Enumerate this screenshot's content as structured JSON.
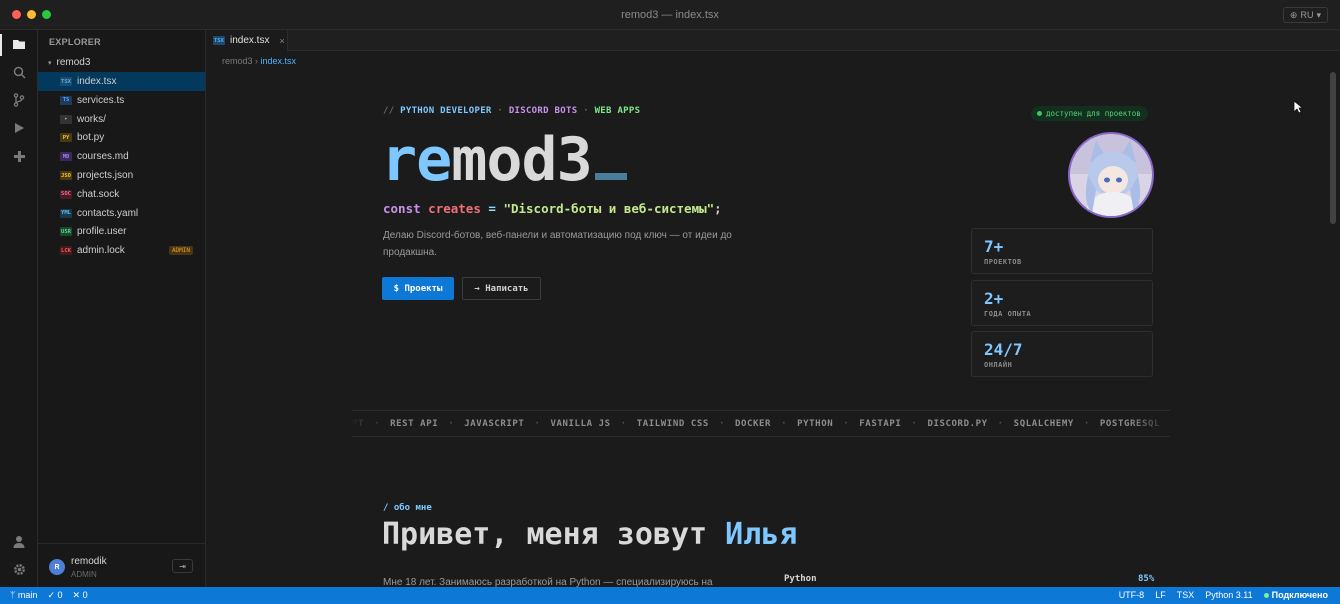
{
  "window": {
    "title": "remod3 — index.tsx",
    "lang": "RU",
    "dots": [
      "#ff5f57",
      "#febc2e",
      "#28c840"
    ]
  },
  "activity_bar": {
    "items": [
      "files-icon",
      "search-icon",
      "source-control-icon",
      "run-icon",
      "extensions-icon"
    ],
    "bottom": [
      "account-icon",
      "settings-icon"
    ]
  },
  "explorer": {
    "title": "EXPLORER",
    "folder": "remod3",
    "files": [
      {
        "badge": "TSX",
        "name": "index.tsx",
        "color": "#4fb0ff",
        "bg": "#1e4a6e"
      },
      {
        "badge": "TS",
        "name": "services.ts",
        "color": "#4fb0ff",
        "bg": "#1e3a5e"
      },
      {
        "badge": "▸",
        "name": "works/",
        "color": "#aaaaaa",
        "bg": "#333333"
      },
      {
        "badge": "PY",
        "name": "bot.py",
        "color": "#f0c040",
        "bg": "#4a3a10"
      },
      {
        "badge": "MD",
        "name": "courses.md",
        "color": "#a080f0",
        "bg": "#3a2a5a"
      },
      {
        "badge": "JSO",
        "name": "projects.json",
        "color": "#f0c040",
        "bg": "#4a3a10"
      },
      {
        "badge": "SOC",
        "name": "chat.sock",
        "color": "#f07080",
        "bg": "#4a1a2a"
      },
      {
        "badge": "YML",
        "name": "contacts.yaml",
        "color": "#60c0f0",
        "bg": "#1a3a4a"
      },
      {
        "badge": "USR",
        "name": "profile.user",
        "color": "#60d090",
        "bg": "#1a4a2a"
      },
      {
        "badge": "LCK",
        "name": "admin.lock",
        "color": "#f06060",
        "bg": "#4a1a1a",
        "tag": "ADMIN"
      }
    ],
    "user": {
      "initial": "R",
      "name": "remodik",
      "role": "ADMIN"
    }
  },
  "editor": {
    "tab": {
      "badge": "TSX",
      "label": "index.tsx",
      "close": "×"
    },
    "breadcrumb": {
      "root": "remod3",
      "sep": " › ",
      "current": "index.tsx"
    }
  },
  "hero": {
    "tagline": [
      {
        "text": "// ",
        "color": "#6a6a6a"
      },
      {
        "text": "PYTHON DEVELOPER",
        "color": "#7ec8ff"
      },
      {
        "text": " · ",
        "color": "#6a6a6a"
      },
      {
        "text": "DISCORD BOTS",
        "color": "#c792ea"
      },
      {
        "text": " · ",
        "color": "#6a6a6a"
      },
      {
        "text": "WEB APPS",
        "color": "#7ee787"
      }
    ],
    "available": "доступен для проектов",
    "title_hl": "re",
    "title_rest": "mod3",
    "code": {
      "kw": "const",
      "name": "creates",
      "op": " = ",
      "str": "\"Discord-боты и веб-системы\"",
      "end": ";"
    },
    "description": "Делаю Discord-ботов, веб-панели и автоматизацию под ключ — от идеи до продакшна.",
    "btn_primary": "$ Проекты",
    "btn_secondary": "→ Написать",
    "stats": [
      {
        "num": "7+",
        "label": "ПРОЕКТОВ"
      },
      {
        "num": "2+",
        "label": "ГОДА ОПЫТА"
      },
      {
        "num": "24/7",
        "label": "ОНЛАЙН"
      }
    ]
  },
  "marquee": {
    "sep": "·",
    "items": [
      "PT",
      "REST API",
      "JAVASCRIPT",
      "VANILLA JS",
      "TAILWIND CSS",
      "DOCKER",
      "PYTHON",
      "FASTAPI",
      "DISCORD.PY",
      "SQLALCHEMY",
      "POSTGRESQL"
    ]
  },
  "about": {
    "tag": "/ обо мне",
    "title": "Привет, меня зовут ",
    "title_hl": "Илья",
    "text": "Мне 18 лет. Занимаюсь разработкой на Python — специализируюсь на",
    "skill": {
      "name": "Python",
      "pct": "85%"
    }
  },
  "statusbar": {
    "branch": "main",
    "checks": "0",
    "errors": "0",
    "right": [
      "UTF-8",
      "LF",
      "TSX",
      "Python 3.11"
    ],
    "live": "Подключено"
  }
}
